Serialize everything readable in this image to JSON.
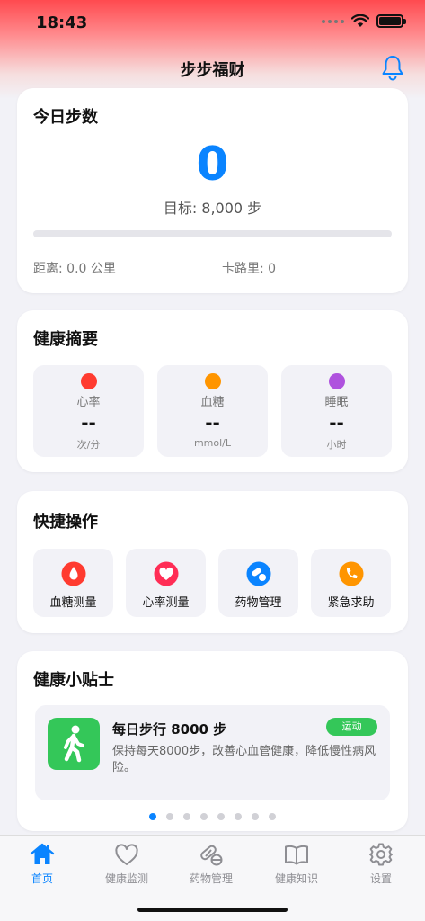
{
  "status_bar": {
    "time": "18:43"
  },
  "header": {
    "title": "步步福财",
    "bell_icon": "bell-icon"
  },
  "steps": {
    "title": "今日步数",
    "count": "0",
    "goal": "目标: 8,000 步",
    "progress": 0,
    "distance": "距离: 0.0 公里",
    "calories": "卡路里: 0"
  },
  "health_summary": {
    "title": "健康摘要",
    "metrics": [
      {
        "label": "心率",
        "value": "--",
        "unit": "次/分",
        "color": "#ff3b30"
      },
      {
        "label": "血糖",
        "value": "--",
        "unit": "mmol/L",
        "color": "#ff9500"
      },
      {
        "label": "睡眠",
        "value": "--",
        "unit": "小时",
        "color": "#af52de"
      }
    ]
  },
  "quick_actions": {
    "title": "快捷操作",
    "items": [
      {
        "label": "血糖测量",
        "icon": "blood-drop-icon",
        "color": "#ff3b30"
      },
      {
        "label": "心率测量",
        "icon": "heart-icon",
        "color": "#ff2d55"
      },
      {
        "label": "药物管理",
        "icon": "pills-icon",
        "color": "#0a84ff"
      },
      {
        "label": "紧急求助",
        "icon": "phone-icon",
        "color": "#ff9500"
      }
    ]
  },
  "tips": {
    "title": "健康小贴士",
    "items": [
      {
        "title": "每日步行 8000 步",
        "tag": "运动",
        "description": "保持每天8000步，改善心血管健康，降低慢性病风险。",
        "icon": "walking-icon"
      }
    ],
    "page_count": 8,
    "active_page": 0
  },
  "tab_bar": {
    "active": 0,
    "tabs": [
      {
        "label": "首页",
        "icon": "home-icon"
      },
      {
        "label": "健康监测",
        "icon": "heart-outline-icon"
      },
      {
        "label": "药物管理",
        "icon": "pill-icon"
      },
      {
        "label": "健康知识",
        "icon": "book-icon"
      },
      {
        "label": "设置",
        "icon": "gear-icon"
      }
    ]
  },
  "colors": {
    "accent": "#0a84ff",
    "tip_green": "#34c759"
  }
}
